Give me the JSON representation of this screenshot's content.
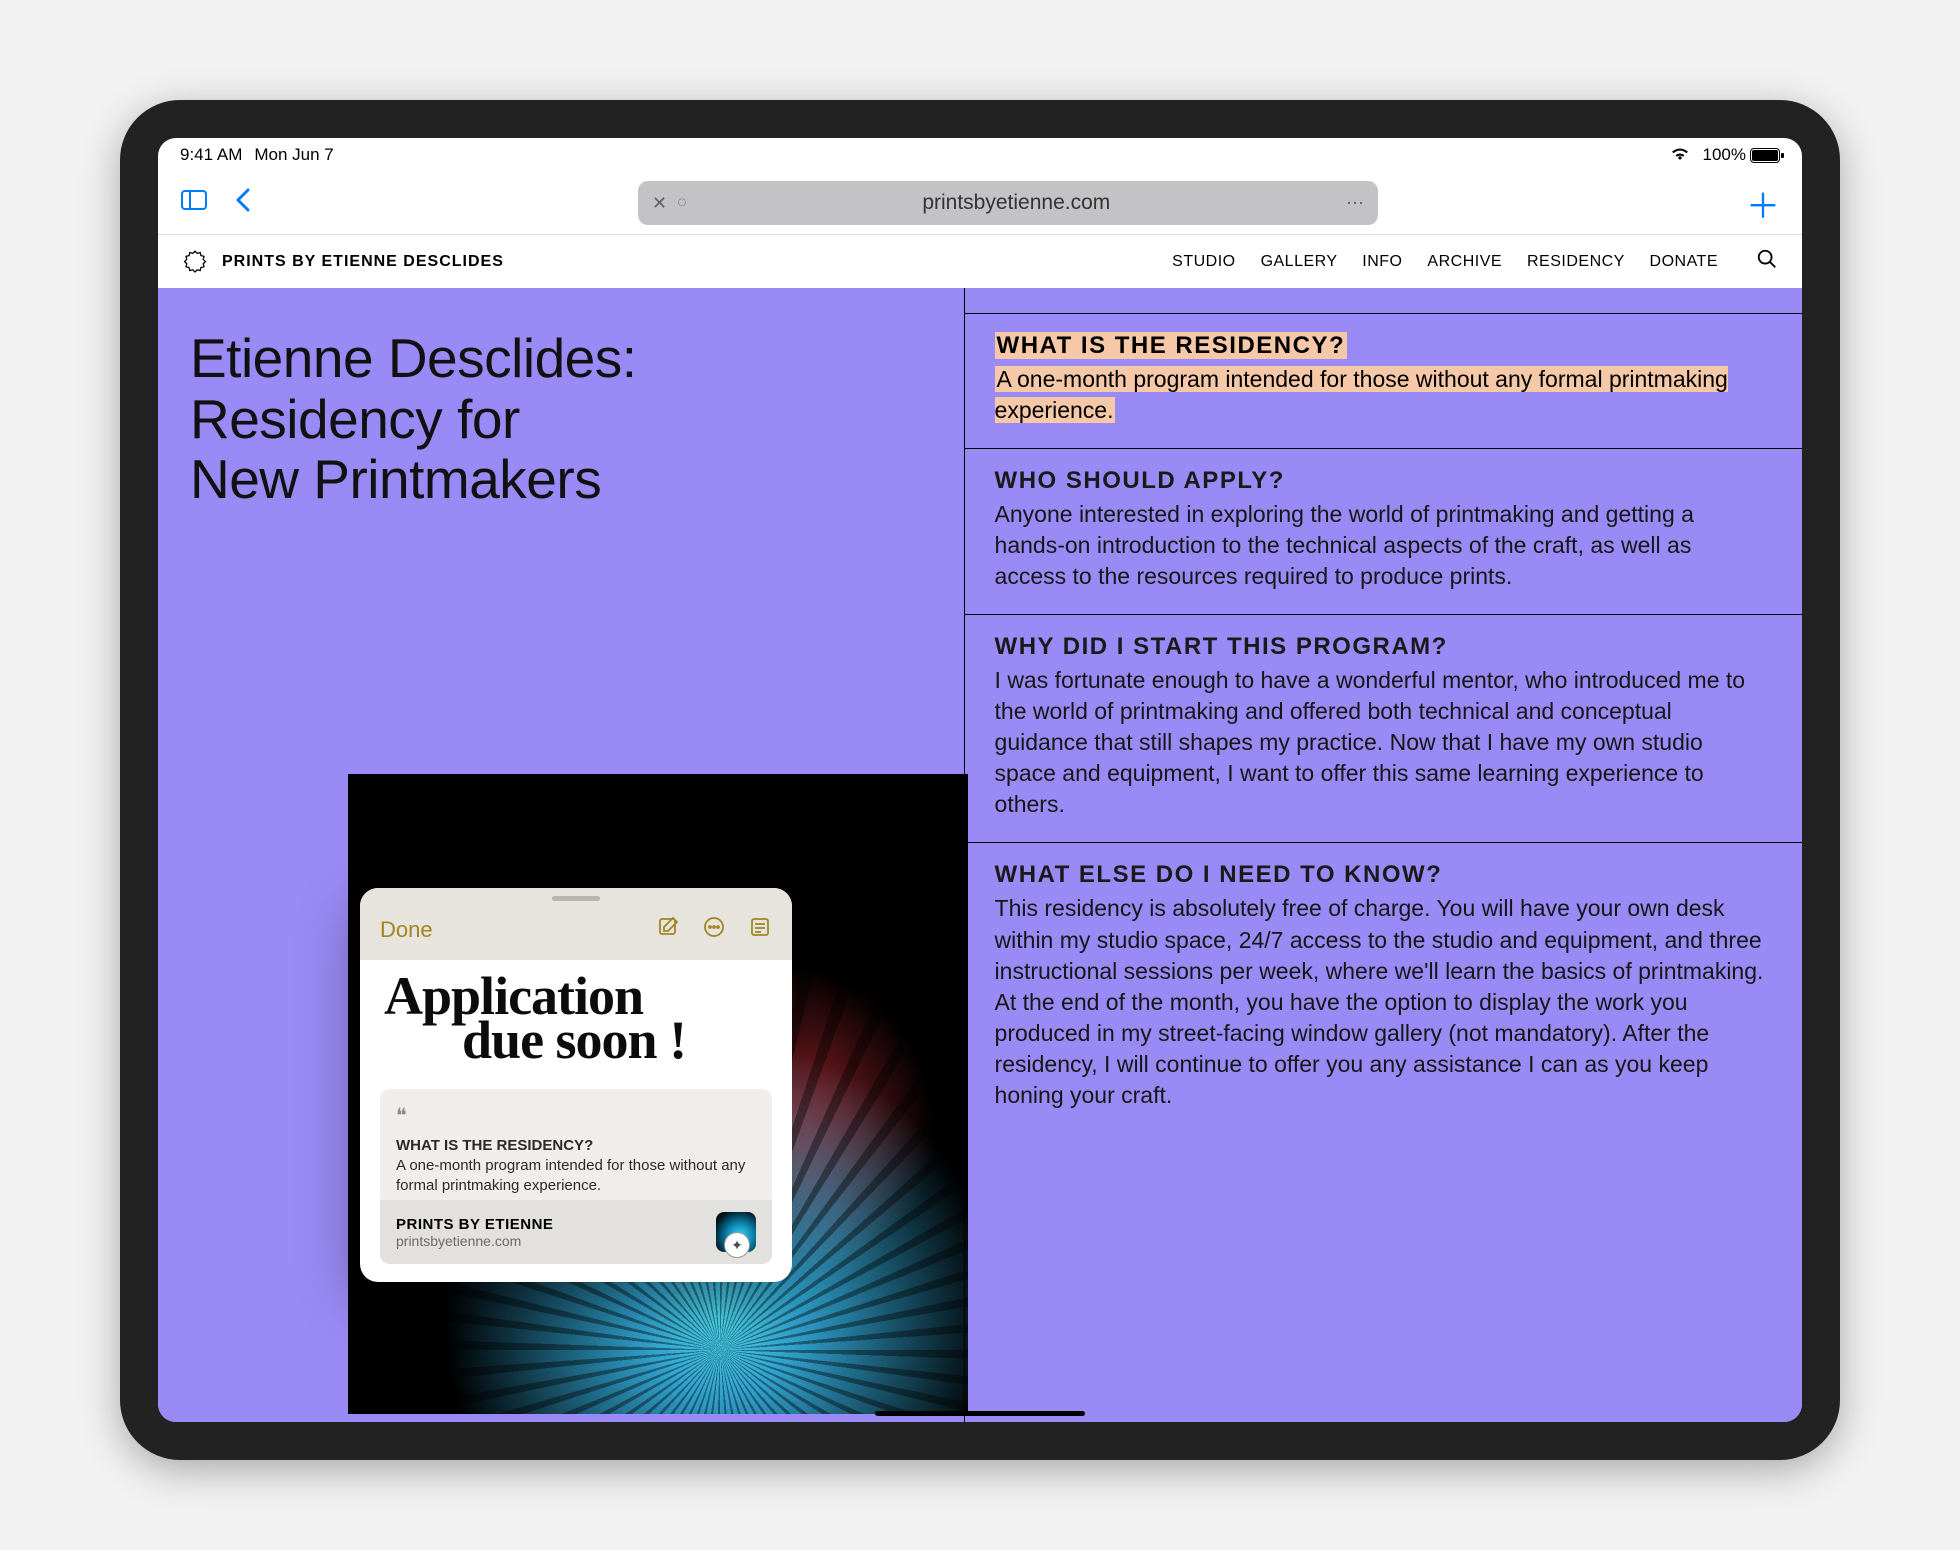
{
  "status": {
    "time": "9:41 AM",
    "date": "Mon Jun 7",
    "battery": "100%"
  },
  "browser": {
    "host": "printsbyetienne.com"
  },
  "site": {
    "title": "PRINTS BY ETIENNE DESCLIDES",
    "nav": {
      "studio": "STUDIO",
      "gallery": "GALLERY",
      "info": "INFO",
      "archive": "ARCHIVE",
      "residency": "RESIDENCY",
      "donate": "DONATE"
    }
  },
  "headline": {
    "l1": "Etienne Desclides:",
    "l2": "Residency for",
    "l3": "New Printmakers"
  },
  "faq": {
    "q1": {
      "h": "WHAT IS THE RESIDENCY?",
      "p": "A one-month program intended for those without any formal printmaking experience."
    },
    "q2": {
      "h": "WHO SHOULD APPLY?",
      "p": "Anyone interested in exploring the world of printmaking and getting a hands-on introduction to the technical aspects of the craft, as well as access to the resources required to produce prints."
    },
    "q3": {
      "h": "WHY DID I START THIS PROGRAM?",
      "p": "I was fortunate enough to have a wonderful mentor, who introduced me to the world of printmaking and offered both technical and conceptual guidance that still shapes my practice. Now that I have my own studio space and equipment, I want to offer this same learning experience to others."
    },
    "q4": {
      "h": "WHAT ELSE DO I NEED TO KNOW?",
      "p": "This residency is absolutely free of charge. You will have your own desk within my studio space, 24/7 access to the studio and equipment, and three instructional sessions per week, where we'll learn the basics of printmaking. At the end of the month, you have the option to display the work you produced in my street-facing window gallery (not mandatory). After the residency, I will continue to offer you any assistance I can as you keep honing your craft."
    }
  },
  "note": {
    "done": "Done",
    "hand1": "Application",
    "hand2": "due soon !",
    "quote_h": "WHAT IS THE RESIDENCY?",
    "quote_p": "A one-month program intended for those without any formal printmaking experience.",
    "src_title": "PRINTS BY ETIENNE",
    "src_host": "printsbyetienne.com"
  }
}
